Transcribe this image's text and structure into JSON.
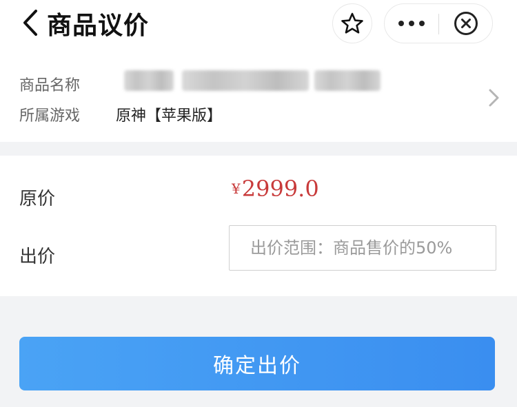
{
  "header": {
    "title": "商品议价",
    "back_icon": "chevron-left-icon",
    "favorite_icon": "star-outline-icon",
    "more_icon": "more-dots-icon",
    "close_icon": "close-circle-icon"
  },
  "product": {
    "name_label": "商品名称",
    "name_value": "",
    "game_label": "所属游戏",
    "game_value": "原神【苹果版】",
    "detail_icon": "chevron-right-icon"
  },
  "pricing": {
    "original_label": "原价",
    "currency_symbol": "¥",
    "original_amount": "2999.0",
    "price_color": "#c83a3a",
    "bid_label": "出价",
    "bid_value": "",
    "bid_placeholder": "出价范围：商品售价的50%"
  },
  "submit": {
    "label": "确定出价",
    "color": "#3a8ef0"
  }
}
